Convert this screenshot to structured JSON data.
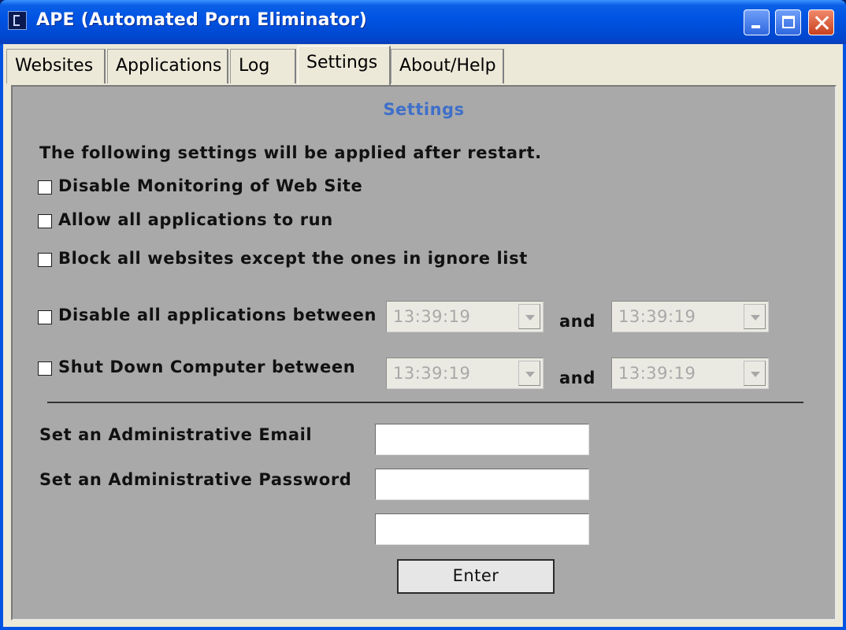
{
  "window": {
    "title": "APE (Automated Porn Eliminator)"
  },
  "tabs": [
    {
      "label": "Websites"
    },
    {
      "label": "Applications"
    },
    {
      "label": "Log"
    },
    {
      "label": "Settings"
    },
    {
      "label": "About/Help"
    }
  ],
  "active_tab": "Settings",
  "settings": {
    "heading": "Settings",
    "note": "The following settings will be applied after restart.",
    "options": {
      "disable_monitoring": {
        "label": "Disable  Monitoring  of  Web Site",
        "checked": false
      },
      "allow_all_apps": {
        "label": "Allow all applications to run",
        "checked": false
      },
      "block_all_except": {
        "label": "Block all websites except the ones in ignore list",
        "checked": false
      },
      "disable_apps_between": {
        "label": "Disable all applications between",
        "checked": false,
        "from": "13:39:19",
        "and": "and",
        "to": "13:39:19"
      },
      "shutdown_between": {
        "label": "Shut Down Computer between",
        "checked": false,
        "from": "13:39:19",
        "and": "and",
        "to": "13:39:19"
      }
    },
    "admin_email_label": "Set an Administrative Email",
    "admin_email_value": "",
    "admin_password_label": "Set an Administrative Password",
    "admin_password_value": "",
    "admin_password_confirm_value": "",
    "enter_label": "Enter"
  }
}
